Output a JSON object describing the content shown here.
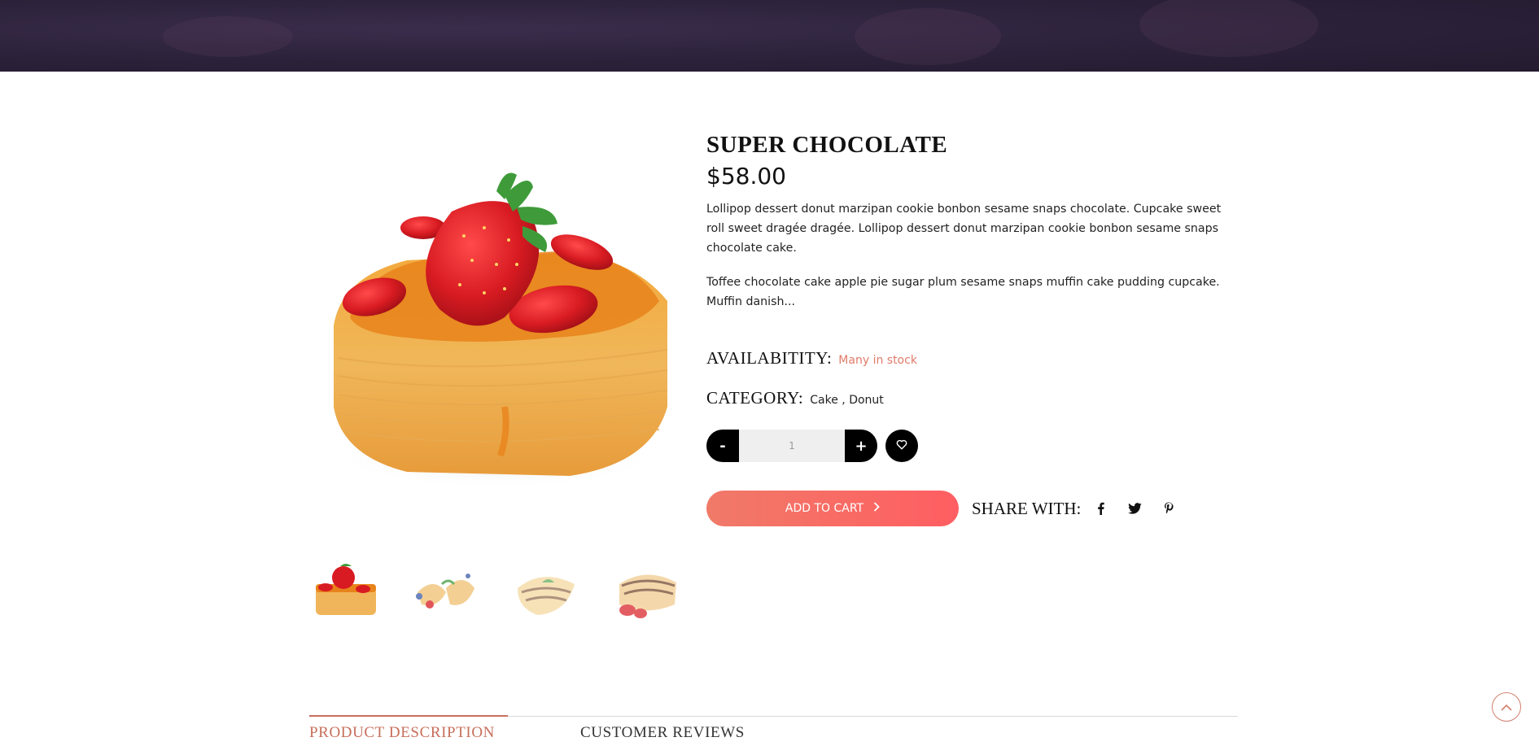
{
  "product": {
    "title": "SUPER CHOCOLATE",
    "price": "$58.00",
    "description_1": "Lollipop dessert donut marzipan cookie bonbon sesame snaps chocolate. Cupcake sweet roll sweet dragée dragée. Lollipop dessert donut marzipan cookie bonbon sesame snaps chocolate cake.",
    "description_2": "Toffee chocolate cake apple pie sugar plum sesame snaps muffin cake pudding cupcake. Muffin danish..."
  },
  "availability": {
    "label": "AVAILABITITY:",
    "value": "Many in stock"
  },
  "category": {
    "label": "CATEGORY:",
    "value": "Cake , Donut"
  },
  "quantity": {
    "minus_label": "-",
    "plus_label": "+",
    "value": "1"
  },
  "add_to_cart": {
    "label": "ADD TO CART"
  },
  "share": {
    "label": "SHARE WITH:",
    "icons": [
      "facebook-icon",
      "twitter-icon",
      "pinterest-icon"
    ]
  },
  "tabs": [
    {
      "label": "PRODUCT DESCRIPTION",
      "active": true
    },
    {
      "label": "CUSTOMER REVIEWS",
      "active": false
    }
  ],
  "colors": {
    "accent": "#e07b6a",
    "tab_active": "#c76f5b",
    "button_gradient_start": "#f07a68",
    "button_gradient_end": "#ff5e62",
    "banner": "#2b2139"
  }
}
